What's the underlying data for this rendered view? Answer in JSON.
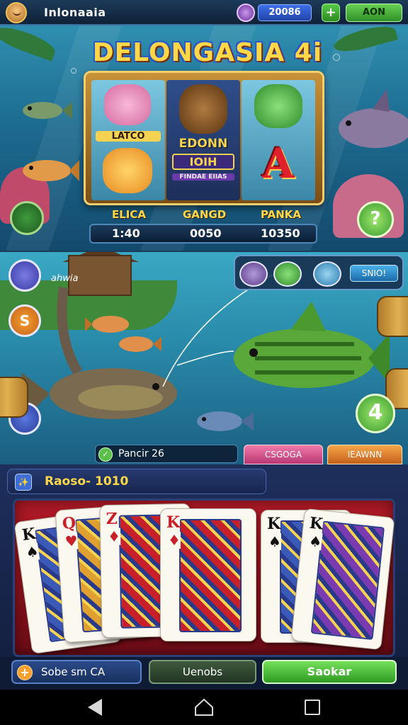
{
  "topbar": {
    "title": "Inlonaaia",
    "coins": "20086",
    "plus_label": "+",
    "action_label": "AON",
    "colors": {
      "coin_box": "#3d6fe8",
      "action": "#4fb83c"
    }
  },
  "slot": {
    "title": "DELONGASIA 4i",
    "reels": {
      "left_caption": "LATCO",
      "center_caption_1": "EDONN",
      "center_caption_2": "IOIH",
      "center_caption_3": "FINDAE EIIAS",
      "right_symbol": "A"
    },
    "stats": [
      {
        "label": "ELICA",
        "value": "1:40"
      },
      {
        "label": "GANGD",
        "value": "0050"
      },
      {
        "label": "PANKA",
        "value": "10350"
      }
    ],
    "side_right_label": "?"
  },
  "fishing": {
    "scene_caption": "ahwia",
    "fishbar_button": "SNIO!",
    "round_left_1_icon": "fish-icon",
    "round_left_2_label": "S",
    "round_right_label": "4",
    "status_text": "Pancir 26",
    "tab_pink": "CSGOGA",
    "tab_orange": "IEAWNN"
  },
  "cards": {
    "header_icon": "✨",
    "header_text": "Raoso- 1010",
    "hand": [
      {
        "rank": "K",
        "suit": "♠",
        "color": "#111111"
      },
      {
        "rank": "Q",
        "suit": "♥",
        "color": "#c8202a"
      },
      {
        "rank": "Z",
        "suit": "♦",
        "color": "#c8202a"
      },
      {
        "rank": "K",
        "suit": "♦",
        "color": "#c8202a"
      },
      {
        "rank": "K",
        "suit": "♠",
        "color": "#111111"
      },
      {
        "rank": "K",
        "suit": "♠",
        "color": "#111111"
      }
    ]
  },
  "bottom": {
    "left_icon": "+",
    "left_label": "Sobe sm CA",
    "mid_label": "Uenobs",
    "right_label": "Saokar"
  },
  "navbar": {
    "back": "back-icon",
    "home": "home-icon",
    "recents": "recents-icon"
  }
}
